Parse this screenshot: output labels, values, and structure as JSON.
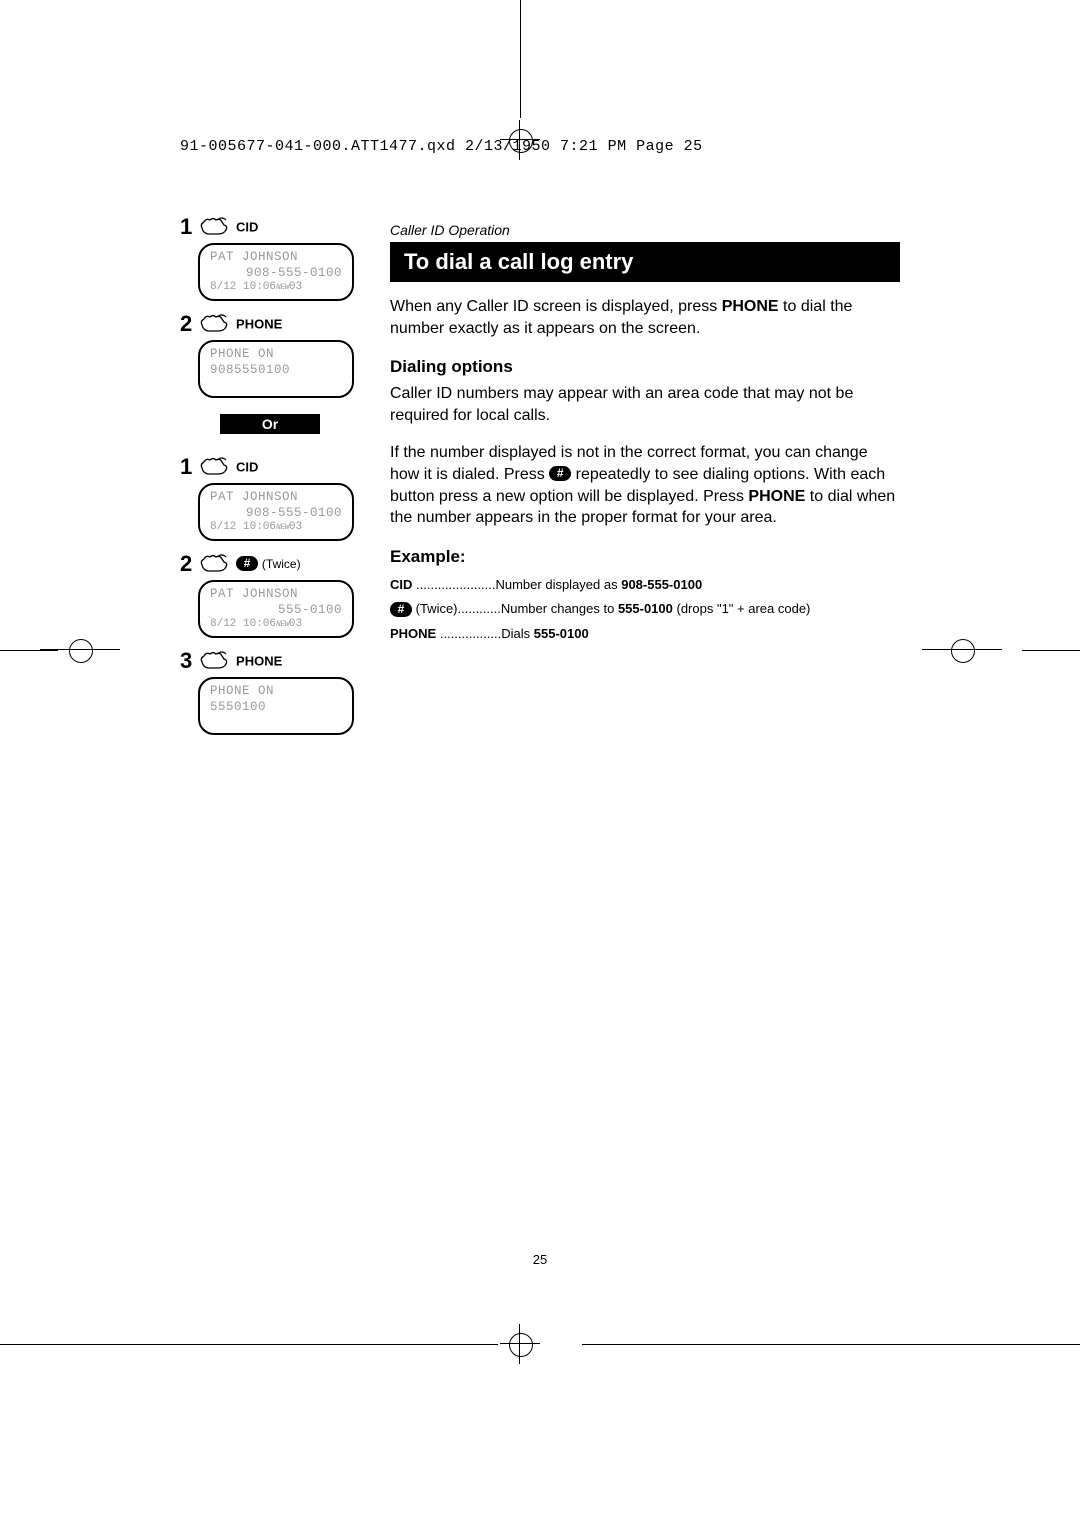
{
  "print_header": "91-005677-041-000.ATT1477.qxd  2/13/1950  7:21 PM  Page 25",
  "page_number": "25",
  "section_label": "Caller ID Operation",
  "title": "To dial a call log entry",
  "intro_a": "When any Caller ID screen is displayed, press ",
  "intro_phone": "PHONE",
  "intro_b": " to dial the number exactly as it appears on the screen.",
  "dialing_options_head": "Dialing options",
  "dialing_p1": "Caller ID numbers may appear with an area code that may not be required for local calls.",
  "dialing_p2a": "If the number displayed is not in the correct format, you can change how it is dialed. Press ",
  "dialing_p2b": " repeatedly to see dialing options. With each button press a new option will be displayed. Press ",
  "dialing_p2_phone": "PHONE",
  "dialing_p2c": " to dial when the number appears in the proper format for your area.",
  "example_head": "Example:",
  "example": {
    "cid_label": "CID",
    "cid_text": "Number displayed as ",
    "cid_num": "908-555-0100",
    "hash_twice": "(Twice)",
    "hash_text": "Number changes to ",
    "hash_num": "555-0100",
    "hash_note": " (drops \"1\" + area code)",
    "phone_label": "PHONE",
    "phone_text": "Dials ",
    "phone_num": "555-0100"
  },
  "left": {
    "step1": "1",
    "cid": "CID",
    "lcd1": {
      "name": "PAT JOHNSON",
      "num": "908-555-0100",
      "bot": "8/12 10:06",
      "new": "NEW",
      "idx": "03"
    },
    "step2": "2",
    "phone": "PHONE",
    "lcd2": {
      "l1": "PHONE ON",
      "l2": "9085550100"
    },
    "or": "Or",
    "b_step1": "1",
    "b_cid": "CID",
    "b_lcd1": {
      "name": "PAT JOHNSON",
      "num": "908-555-0100",
      "bot": "8/12 10:06",
      "new": "NEW",
      "idx": "03"
    },
    "b_step2": "2",
    "twice": "(Twice)",
    "b_lcd2": {
      "name": "PAT JOHNSON",
      "num": "555-0100",
      "bot": "8/12 10:06",
      "new": "NEW",
      "idx": "03"
    },
    "b_step3": "3",
    "b_phone": "PHONE",
    "b_lcd3": {
      "l1": "PHONE ON",
      "l2": "5550100"
    }
  },
  "hash_glyph": "#"
}
